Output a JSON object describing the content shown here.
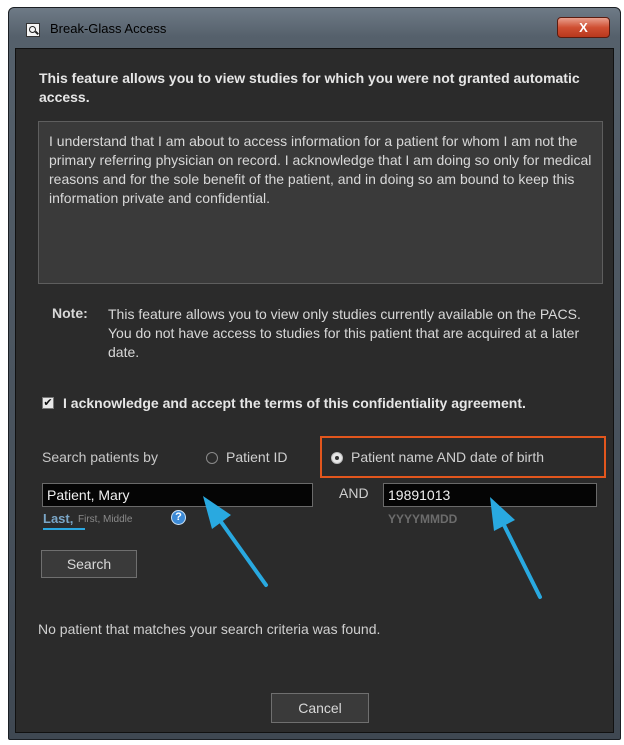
{
  "window": {
    "title": "Break-Glass Access",
    "close_label": "X"
  },
  "intro_text": "This feature allows you to view studies for which you were not granted automatic access.",
  "terms_text": "I understand that I am about to access information for a patient for whom I am not the primary referring physician on record. I acknowledge that I am doing so only for medical reasons and for the sole benefit of the patient, and in doing so am bound to keep this information private and confidential.",
  "note": {
    "label": "Note:",
    "text": "This feature allows you to view only studies currently available on the PACS. You do not have access to studies for this patient that are acquired at a later date."
  },
  "acknowledge": {
    "checked": true,
    "check_glyph": "✔",
    "label": "I acknowledge and accept the terms of this confidentiality agreement."
  },
  "search": {
    "by_label": "Search patients by",
    "option_patient_id": "Patient ID",
    "option_name_dob": "Patient name AND date of birth",
    "selected": "name_dob",
    "name_value": "Patient, Mary",
    "and_label": "AND",
    "dob_value": "19891013",
    "name_hint_last": "Last,",
    "name_hint_rest": "First, Middle",
    "help_glyph": "?",
    "dob_hint": "YYYYMMDD",
    "button_label": "Search"
  },
  "result_message": "No patient that matches your search criteria was found.",
  "cancel_label": "Cancel",
  "colors": {
    "highlight_box": "#e2561d",
    "annotation_arrow": "#29a9e0",
    "dialog_background": "#2b2b2b",
    "close_button": "#cf4f32"
  }
}
